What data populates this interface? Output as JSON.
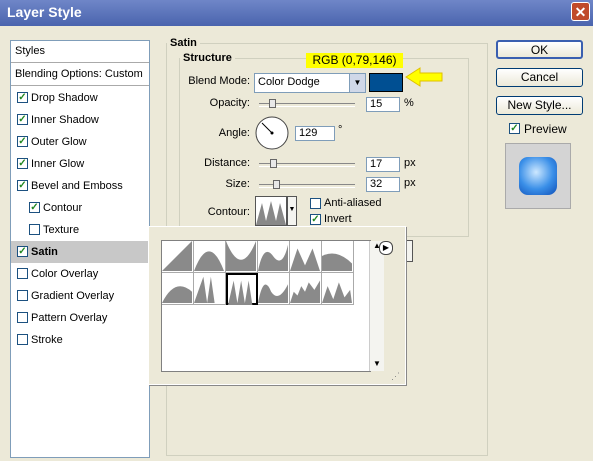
{
  "window": {
    "title": "Layer Style",
    "close_glyph": "✕"
  },
  "styles_panel": {
    "header": "Styles",
    "blending": "Blending Options: Custom",
    "items": [
      {
        "label": "Drop Shadow",
        "checked": true
      },
      {
        "label": "Inner Shadow",
        "checked": true
      },
      {
        "label": "Outer Glow",
        "checked": true
      },
      {
        "label": "Inner Glow",
        "checked": true
      },
      {
        "label": "Bevel and Emboss",
        "checked": true
      },
      {
        "label": "Contour",
        "checked": true
      },
      {
        "label": "Texture",
        "checked": false
      },
      {
        "label": "Satin",
        "checked": true,
        "selected": true
      },
      {
        "label": "Color Overlay",
        "checked": false
      },
      {
        "label": "Gradient Overlay",
        "checked": false
      },
      {
        "label": "Pattern Overlay",
        "checked": false
      },
      {
        "label": "Stroke",
        "checked": false
      }
    ]
  },
  "satin": {
    "group_title": "Satin",
    "structure_title": "Structure",
    "blend_mode_label": "Blend Mode:",
    "blend_mode": "Color Dodge",
    "color": "#004f92",
    "opacity_label": "Opacity:",
    "opacity": "15",
    "opacity_unit": "%",
    "angle_label": "Angle:",
    "angle": "129",
    "angle_unit": "°",
    "distance_label": "Distance:",
    "distance": "17",
    "distance_unit": "px",
    "size_label": "Size:",
    "size": "32",
    "size_unit": "px",
    "contour_label": "Contour:",
    "anti_aliased_label": "Anti-aliased",
    "anti_aliased": false,
    "invert_label": "Invert",
    "invert": true
  },
  "annotation": {
    "text": "RGB (0,79,146)",
    "color": "#ffff00"
  },
  "buttons": {
    "ok": "OK",
    "cancel": "Cancel",
    "new_style": "New Style...",
    "preview_label": "Preview",
    "preview": true
  },
  "contour_picker": {
    "rows": 2,
    "cols": 6,
    "selected_index": 8
  }
}
